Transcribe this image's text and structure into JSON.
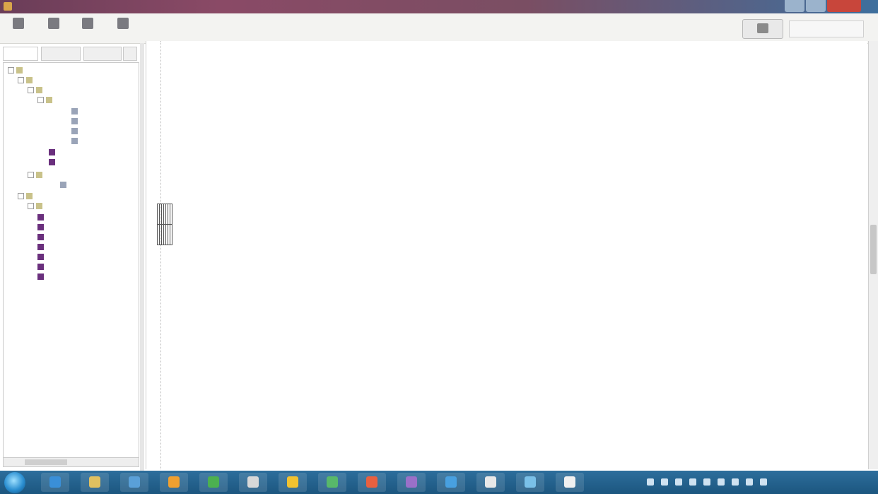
{
  "window": {
    "title": ""
  },
  "toolbar": {
    "buttons": [
      {
        "name": "toolbar-btn-1",
        "label": ""
      },
      {
        "name": "toolbar-btn-2",
        "label": ""
      },
      {
        "name": "toolbar-btn-3",
        "label": ""
      },
      {
        "name": "toolbar-btn-4",
        "label": ""
      }
    ]
  },
  "left_panel": {
    "tabs": [
      {
        "label": ""
      },
      {
        "label": ""
      },
      {
        "label": ""
      }
    ]
  },
  "document": {
    "table": {
      "unit_label": "",
      "header_row": [
        "",
        "",
        "",
        "",
        "",
        "",
        "",
        ""
      ],
      "value_row": [
        "",
        "",
        "",
        "",
        "",
        "",
        "",
        ""
      ]
    }
  },
  "taskbar": {
    "clock_time": "",
    "clock_date": ""
  },
  "colors": {
    "titlebar": "#7a4e63",
    "taskbar": "#1c567f",
    "tree_node_purple": "#6a2f7d"
  }
}
